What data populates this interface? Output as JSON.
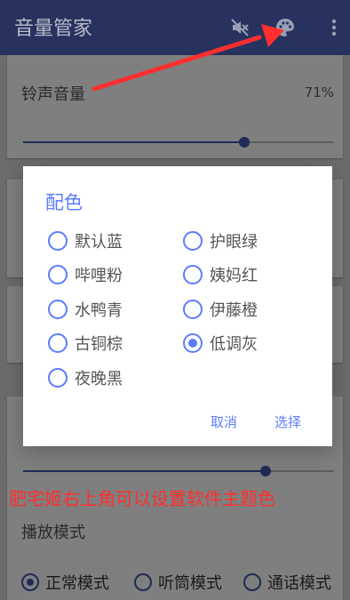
{
  "app": {
    "title": "音量管家"
  },
  "toolbar": {
    "mute_icon": "volume-off-icon",
    "palette_icon": "palette-icon",
    "menu_icon": "more-vert-icon"
  },
  "settings": {
    "ringtone": {
      "label": "铃声音量",
      "percent_text": "71%",
      "value": 71
    },
    "lower_slider_value": 78,
    "play_mode": {
      "label": "播放模式",
      "options": [
        {
          "label": "正常模式",
          "selected": true
        },
        {
          "label": "听筒模式",
          "selected": false
        },
        {
          "label": "通话模式",
          "selected": false
        }
      ]
    }
  },
  "dialog": {
    "title": "配色",
    "options": [
      {
        "label": "默认蓝",
        "checked": false
      },
      {
        "label": "护眼绿",
        "checked": false
      },
      {
        "label": "哔哩粉",
        "checked": false
      },
      {
        "label": "姨妈红",
        "checked": false
      },
      {
        "label": "水鸭青",
        "checked": false
      },
      {
        "label": "伊藤橙",
        "checked": false
      },
      {
        "label": "古铜棕",
        "checked": false
      },
      {
        "label": "低调灰",
        "checked": true
      },
      {
        "label": "夜晚黑",
        "checked": false
      }
    ],
    "cancel_label": "取消",
    "confirm_label": "选择"
  },
  "annotation": {
    "text": "肥宅姬右上角可以设置软件主题色"
  },
  "colors": {
    "appbar": "#27325f",
    "accent": "#5b7cff",
    "annotation": "#ff2f2f"
  }
}
